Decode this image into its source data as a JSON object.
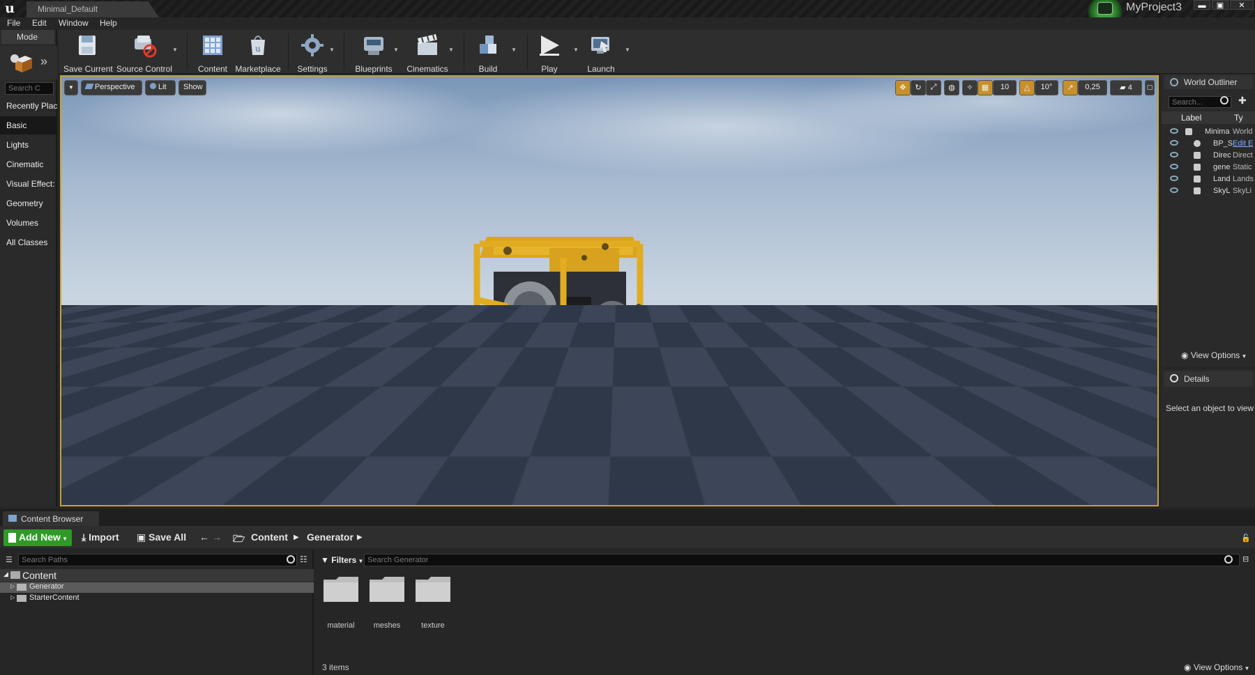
{
  "titlebar": {
    "doc_tab": "Minimal_Default",
    "project": "MyProject3",
    "win_min": "▬",
    "win_max": "▣",
    "win_close": "✕"
  },
  "menu": [
    "File",
    "Edit",
    "Window",
    "Help"
  ],
  "modes": {
    "tab": "Mode",
    "search_placeholder": "Search C",
    "categories": [
      "Recently Plac",
      "Basic",
      "Lights",
      "Cinematic",
      "Visual Effect:",
      "Geometry",
      "Volumes",
      "All Classes"
    ],
    "active_index": 1
  },
  "toolbar": {
    "save_current": "Save Current",
    "source_control": "Source Control",
    "content": "Content",
    "marketplace": "Marketplace",
    "settings": "Settings",
    "blueprints": "Blueprints",
    "cinematics": "Cinematics",
    "build": "Build",
    "play": "Play",
    "launch": "Launch"
  },
  "viewport": {
    "perspective": "Perspective",
    "lit": "Lit",
    "show": "Show",
    "grid_snap": "10",
    "rot_snap": "10°",
    "scale_snap": "0,25",
    "cam_speed": "4"
  },
  "outliner": {
    "tab": "World Outliner",
    "search_placeholder": "Search...",
    "col_label": "Label",
    "col_type": "Ty",
    "rows": [
      {
        "label": "Minima",
        "type": "World"
      },
      {
        "label": "BP_S",
        "type": "Edit E"
      },
      {
        "label": "Direc",
        "type": "Direct"
      },
      {
        "label": "gene",
        "type": "Static"
      },
      {
        "label": "Land",
        "type": "Lands"
      },
      {
        "label": "SkyL",
        "type": "SkyLi"
      }
    ],
    "view_options": "View Options"
  },
  "details": {
    "tab": "Details",
    "hint": "Select an object to view d"
  },
  "content_browser": {
    "tab": "Content Browser",
    "add_new": "Add New",
    "import": "Import",
    "save_all": "Save All",
    "breadcrumb": [
      "Content",
      "Generator"
    ],
    "path_search_placeholder": "Search Paths",
    "tree_root": "Content",
    "tree_items": [
      "Generator",
      "StarterContent"
    ],
    "filters": "Filters",
    "asset_search_placeholder": "Search Generator",
    "folders": [
      "material",
      "meshes",
      "texture"
    ],
    "item_count": "3 items",
    "view_options": "View Options"
  },
  "colors": {
    "accent": "#c7a235",
    "add_new": "#2f9a27",
    "viewport_border": "#c7a235"
  }
}
